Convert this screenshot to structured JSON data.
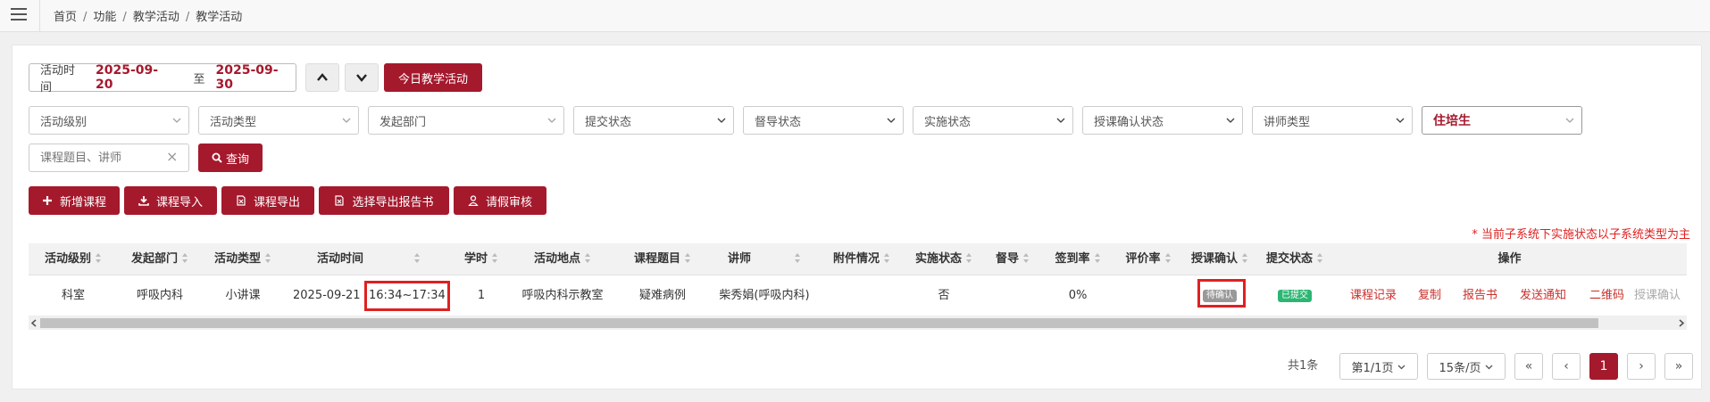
{
  "breadcrumb": [
    "首页",
    "功能",
    "教学活动",
    "教学活动"
  ],
  "date_filter": {
    "label": "活动时间",
    "start": "2025-09-20",
    "to": "至",
    "end": "2025-09-30"
  },
  "today_button": "今日教学活动",
  "filters": [
    {
      "label": "活动级别"
    },
    {
      "label": "活动类型"
    },
    {
      "label": "发起部门"
    },
    {
      "label": "提交状态"
    },
    {
      "label": "督导状态"
    },
    {
      "label": "实施状态"
    },
    {
      "label": "授课确认状态"
    },
    {
      "label": "讲师类型"
    },
    {
      "label": "住培生"
    }
  ],
  "search": {
    "placeholder": "课程题目、讲师",
    "clear": "×",
    "button": "查询"
  },
  "actions": [
    "新增课程",
    "课程导入",
    "课程导出",
    "选择导出报告书",
    "请假审核"
  ],
  "note": "* 当前子系统下实施状态以子系统类型为主",
  "columns": [
    "活动级别",
    "发起部门",
    "活动类型",
    "活动时间",
    "学时",
    "活动地点",
    "课程题目",
    "讲师",
    "附件情况",
    "实施状态",
    "督导",
    "签到率",
    "评价率",
    "授课确认",
    "提交状态",
    "操作"
  ],
  "row": {
    "level": "科室",
    "dept": "呼吸内科",
    "type": "小讲课",
    "date": "2025-09-21",
    "time": "16:34~17:34",
    "hours": "1",
    "location": "呼吸内科示教室",
    "topic": "疑难病例",
    "lecturer": "柴秀娟(呼吸内科)",
    "attachment": "",
    "implemented": "否",
    "supervision": "",
    "signin_rate": "0%",
    "eval_rate": "",
    "confirm": "待确认",
    "submit": "已提交",
    "ops": [
      "课程记录",
      "复制",
      "报告书",
      "发送通知",
      "二维码",
      "授课确认"
    ]
  },
  "pagination": {
    "total": "共1条",
    "page_select": "第1/1页",
    "size_select": "15条/页",
    "first": "«",
    "prev": "‹",
    "current": "1",
    "next": "›",
    "last": "»"
  },
  "colors": {
    "primary": "#a5192d",
    "alert": "#e02020",
    "success": "#2bb673",
    "pending": "#999999"
  }
}
